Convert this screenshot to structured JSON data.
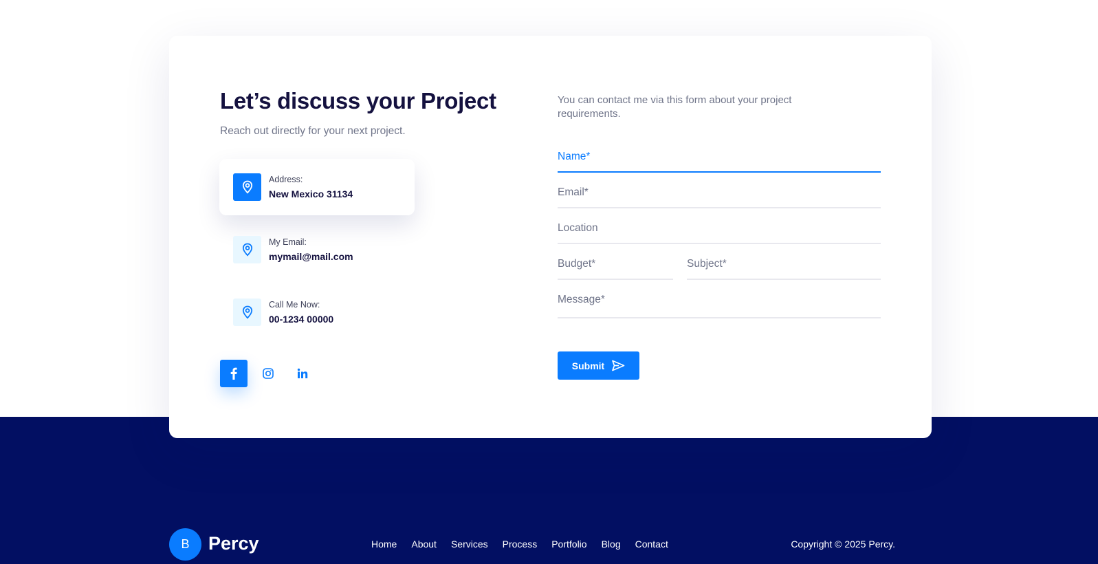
{
  "colors": {
    "accent": "#0a7cff",
    "heading": "#14113f",
    "footer_bg": "#020f62",
    "icon_bg_soft": "#e8f7ff"
  },
  "contact": {
    "title": "Let’s discuss your Project",
    "subtitle": "Reach out directly for your next project.",
    "items": [
      {
        "label": "Address:",
        "value": "New Mexico 31134",
        "icon": "location-pin-icon"
      },
      {
        "label": "My Email:",
        "value": "mymail@mail.com",
        "icon": "location-pin-icon"
      },
      {
        "label": "Call Me Now:",
        "value": "00-1234 00000",
        "icon": "location-pin-icon"
      }
    ],
    "social": [
      "facebook-icon",
      "instagram-icon",
      "linkedin-icon"
    ]
  },
  "form": {
    "intro": "You can contact me via this form about your project requirements.",
    "fields": {
      "name": "Name*",
      "email": "Email*",
      "location": "Location",
      "budget": "Budget*",
      "subject": "Subject*",
      "message": "Message*"
    },
    "submit_label": "Submit"
  },
  "footer": {
    "logo_letter": "B",
    "brand": "Percy",
    "nav": [
      "Home",
      "About",
      "Services",
      "Process",
      "Portfolio",
      "Blog",
      "Contact"
    ],
    "copyright": "Copyright © 2025 Percy."
  }
}
